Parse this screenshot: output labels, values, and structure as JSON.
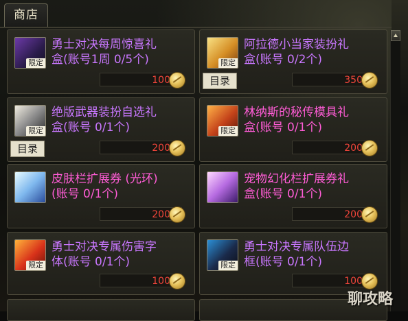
{
  "tab": {
    "label": "商店"
  },
  "items": [
    {
      "name_lines": [
        "勇士对决每周惊喜礼",
        "盒(账号1周 0/5个)"
      ],
      "name_color": "#c977ff",
      "tag": "限定",
      "price": "100",
      "catalog": "",
      "art": "art-helmet"
    },
    {
      "name_lines": [
        "阿拉德小当家装扮礼",
        "盒(账号 0/2个)"
      ],
      "name_color": "#c977ff",
      "tag": "限定",
      "price": "350",
      "catalog": "目录",
      "art": "art-gift-gold"
    },
    {
      "name_lines": [
        "绝版武器装扮自选礼",
        "盒(账号 0/1个)"
      ],
      "name_color": "#c977ff",
      "tag": "限定",
      "price": "200",
      "catalog": "目录",
      "art": "art-sword"
    },
    {
      "name_lines": [
        "林纳斯的秘传模具礼",
        "盒(账号 0/1个)"
      ],
      "name_color": "#ff5cd6",
      "tag": "限定",
      "price": "200",
      "catalog": "",
      "art": "art-mold"
    },
    {
      "name_lines": [
        "皮肤栏扩展券 (光环)",
        "(账号 0/1个)"
      ],
      "name_color": "#ff5cd6",
      "tag": "",
      "price": "200",
      "catalog": "",
      "art": "art-halo"
    },
    {
      "name_lines": [
        "宠物幻化栏扩展券礼",
        "盒(账号 0/1个)"
      ],
      "name_color": "#ff5cd6",
      "tag": "",
      "price": "200",
      "catalog": "",
      "art": "art-pet"
    },
    {
      "name_lines": [
        "勇士对决专属伤害字",
        "体(账号 0/1个)"
      ],
      "name_color": "#c977ff",
      "tag": "限定",
      "price": "100",
      "catalog": "",
      "art": "art-font"
    },
    {
      "name_lines": [
        "勇士对决专属队伍边",
        "框(账号 0/1个)"
      ],
      "name_color": "#c977ff",
      "tag": "限定",
      "price": "100",
      "catalog": "",
      "art": "art-frame"
    }
  ],
  "watermark": "聊攻略"
}
